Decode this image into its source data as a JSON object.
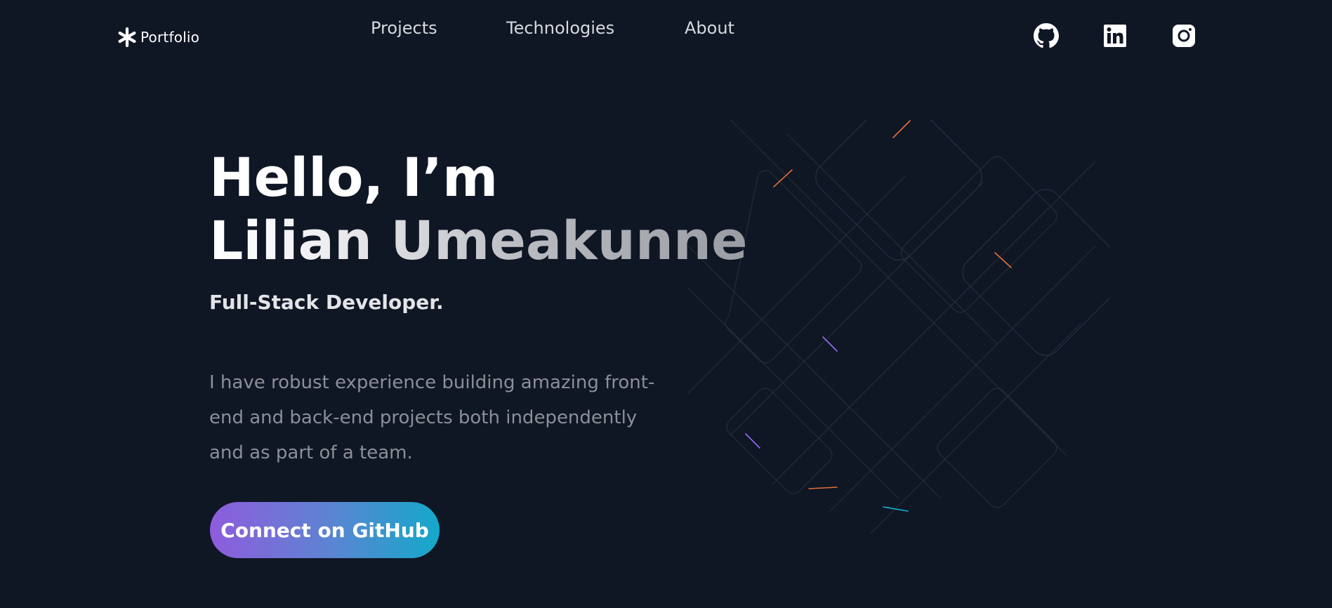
{
  "header": {
    "logo_text": "Portfolio",
    "nav": [
      {
        "label": "Projects"
      },
      {
        "label": "Technologies"
      },
      {
        "label": "About"
      }
    ],
    "social_icons": [
      "github-icon",
      "linkedin-icon",
      "instagram-icon"
    ]
  },
  "hero": {
    "title_line1": "Hello, I’m",
    "title_line2": "Lilian Umeakunne",
    "subtitle": "Full-Stack Developer.",
    "description": "I have robust experience building amazing front-end and back-end projects both independently and as part of a team.",
    "cta_label": "Connect on GitHub"
  },
  "colors": {
    "background": "#0f1624",
    "cta_gradient_start": "#8e5cdd",
    "cta_gradient_end": "#14a9c9",
    "text_primary": "#ffffff",
    "text_muted": "#8c8f97"
  }
}
